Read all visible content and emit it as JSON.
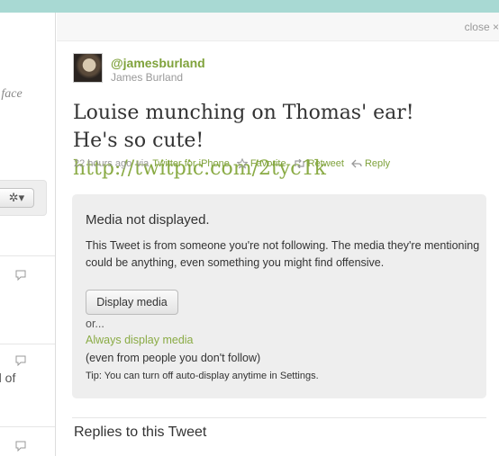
{
  "left_column": {
    "fragment_1": "t face",
    "fragment_2": "d of",
    "gear_icon": "gear-icon",
    "gear_glyph": "✲▾",
    "bubble_icon": "speech-bubble-icon"
  },
  "panel": {
    "close_label": "close ×"
  },
  "tweet": {
    "avatar_icon": "user-avatar",
    "username": "@jamesburland",
    "full_name": "James Burland",
    "text_prefix": "Louise munching on Thomas' ear! He's so cute! ",
    "link": "http://twitpic.com/2tyc1k",
    "time": "22 hours ago",
    "via_label": "via",
    "source": "Twitter for iPhone",
    "favorite_label": "Favorite",
    "retweet_label": "Retweet",
    "reply_label": "Reply"
  },
  "media_notice": {
    "title": "Media not displayed.",
    "body": "This Tweet is from someone you're not following. The media they're mentioning could be anything, even something you might find offensive.",
    "display_button": "Display media",
    "or_text": "or...",
    "always_link": "Always display media",
    "even_text": "(even from people you don't follow)",
    "tip": "Tip: You can turn off auto-display anytime in Settings."
  },
  "replies": {
    "heading": "Replies to this Tweet"
  },
  "colors": {
    "top_bar": "#a8d9d3",
    "link_green": "#8aab45",
    "username_green": "#7fa23b",
    "media_box_bg": "#eeeeee"
  }
}
